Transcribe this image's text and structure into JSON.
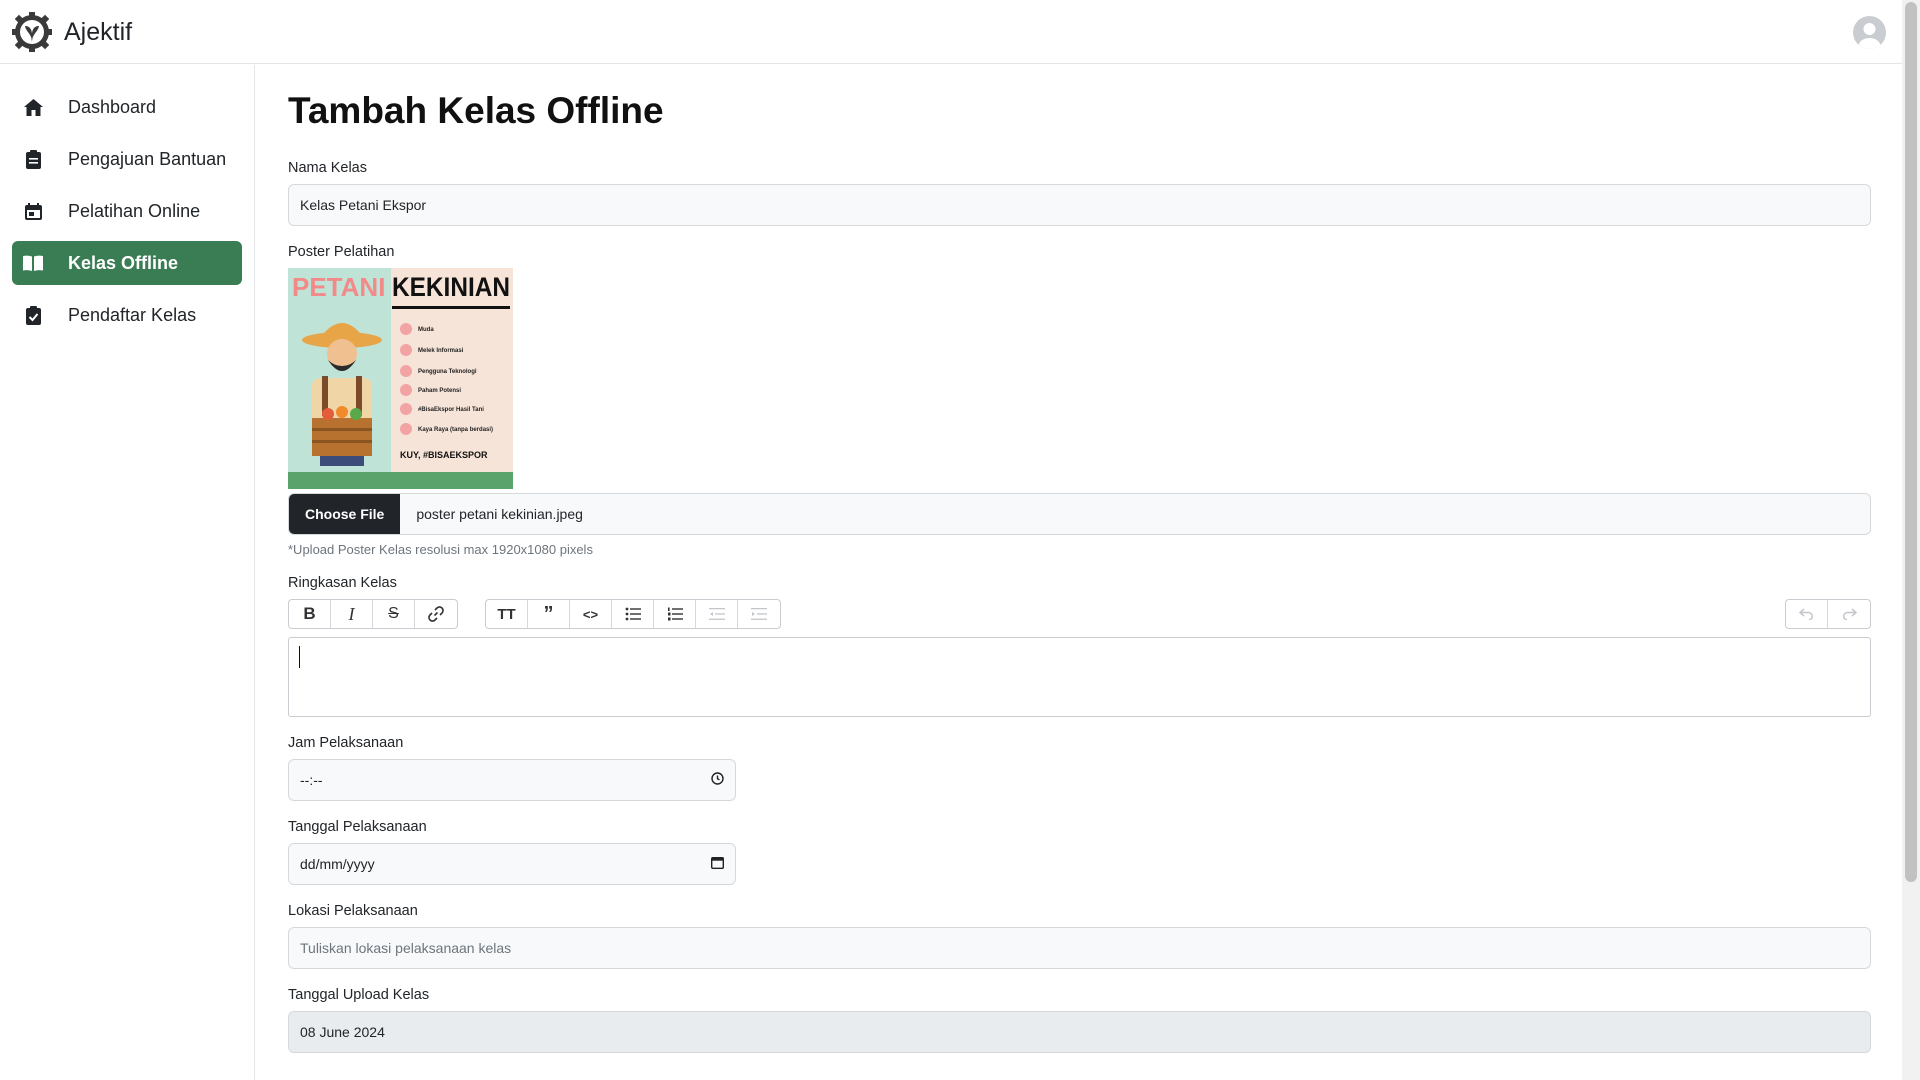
{
  "app": {
    "brand": "Ajektif"
  },
  "sidebar": {
    "items": [
      {
        "label": "Dashboard",
        "icon": "home-icon",
        "active": false
      },
      {
        "label": "Pengajuan Bantuan",
        "icon": "clipboard-icon",
        "active": false
      },
      {
        "label": "Pelatihan Online",
        "icon": "calendar-icon",
        "active": false
      },
      {
        "label": "Kelas Offline",
        "icon": "book-open-icon",
        "active": true
      },
      {
        "label": "Pendaftar Kelas",
        "icon": "clipboard-check-icon",
        "active": false
      }
    ],
    "active_color": "#3a7d54"
  },
  "page": {
    "title": "Tambah Kelas Offline"
  },
  "form": {
    "nama_kelas": {
      "label": "Nama Kelas",
      "value": "Kelas Petani Ekspor"
    },
    "poster": {
      "label": "Poster Pelatihan",
      "button": "Choose File",
      "file_name": "poster petani kekinian.jpeg",
      "hint": "*Upload Poster Kelas resolusi max 1920x1080 pixels",
      "image_text": {
        "word1": "PETANI",
        "word2": "KEKINIAN",
        "items": [
          "Muda",
          "Melek Informasi",
          "Pengguna Teknologi",
          "Paham Potensi",
          "#BisaEkspor Hasil Tani",
          "Kaya Raya (tanpa berdasi)"
        ],
        "footer": "KUY, #BISAEKSPOR"
      }
    },
    "ringkasan": {
      "label": "Ringkasan Kelas"
    },
    "jam": {
      "label": "Jam Pelaksanaan",
      "value": "--:--"
    },
    "tanggal": {
      "label": "Tanggal Pelaksanaan",
      "value": "dd/mm/yyyy"
    },
    "lokasi": {
      "label": "Lokasi Pelaksanaan",
      "placeholder": "Tuliskan lokasi pelaksanaan kelas"
    },
    "upload_date": {
      "label": "Tanggal Upload Kelas",
      "value": "08 June 2024"
    }
  },
  "editor_toolbar": {
    "group1": [
      "bold-icon",
      "italic-icon",
      "strikethrough-icon",
      "link-icon"
    ],
    "group2": [
      "heading-icon",
      "quote-icon",
      "code-icon",
      "bullet-list-icon",
      "numbered-list-icon",
      "outdent-icon",
      "indent-icon"
    ],
    "group3": [
      "undo-icon",
      "redo-icon"
    ]
  }
}
